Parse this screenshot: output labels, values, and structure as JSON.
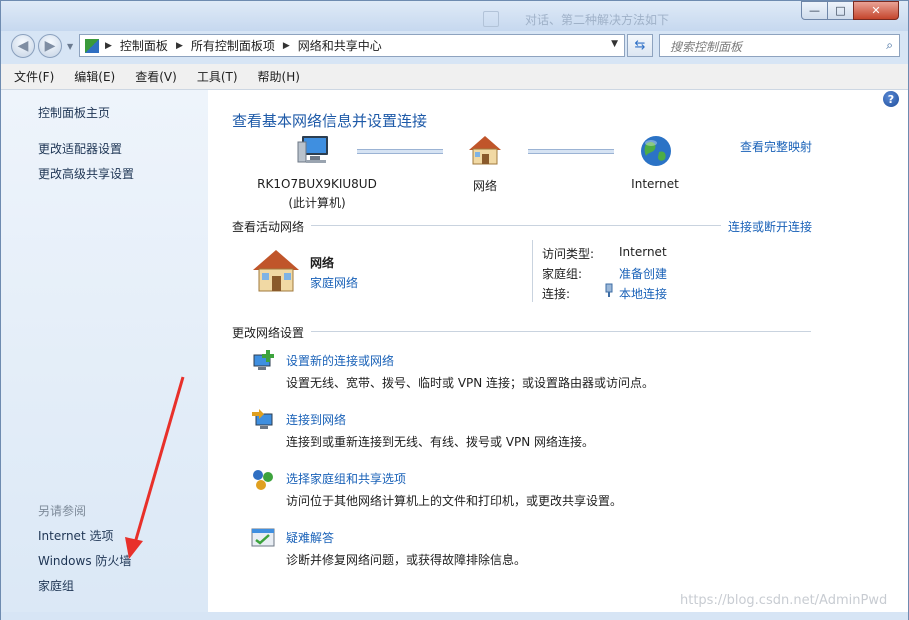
{
  "window": {
    "ghost_text": "对话、第二种解决方法如下",
    "controls": {
      "minimize": "—",
      "maximize": "□",
      "close": "✕"
    }
  },
  "nav": {
    "breadcrumb": [
      "控制面板",
      "所有控制面板项",
      "网络和共享中心"
    ],
    "search_placeholder": "搜索控制面板"
  },
  "menubar": [
    "文件(F)",
    "编辑(E)",
    "查看(V)",
    "工具(T)",
    "帮助(H)"
  ],
  "sidebar": {
    "links": [
      "控制面板主页",
      "更改适配器设置",
      "更改高级共享设置"
    ],
    "see_also_title": "另请参阅",
    "see_also": [
      "Internet 选项",
      "Windows 防火墙",
      "家庭组"
    ]
  },
  "main": {
    "title": "查看基本网络信息并设置连接",
    "view_full_map": "查看完整映射",
    "nodes": {
      "computer_name": "RK1O7BUX9KIU8UD",
      "computer_sub": "(此计算机)",
      "network": "网络",
      "internet": "Internet"
    },
    "active_networks_label": "查看活动网络",
    "connect_disconnect": "连接或断开连接",
    "active": {
      "name": "网络",
      "type": "家庭网络",
      "access_type_label": "访问类型:",
      "access_type_value": "Internet",
      "homegroup_label": "家庭组:",
      "homegroup_value": "准备创建",
      "connection_label": "连接:",
      "connection_value": "本地连接"
    },
    "change_settings_label": "更改网络设置",
    "tasks": [
      {
        "title": "设置新的连接或网络",
        "desc": "设置无线、宽带、拨号、临时或 VPN 连接；或设置路由器或访问点。"
      },
      {
        "title": "连接到网络",
        "desc": "连接到或重新连接到无线、有线、拨号或 VPN 网络连接。"
      },
      {
        "title": "选择家庭组和共享选项",
        "desc": "访问位于其他网络计算机上的文件和打印机，或更改共享设置。"
      },
      {
        "title": "疑难解答",
        "desc": "诊断并修复网络问题，或获得故障排除信息。"
      }
    ]
  },
  "watermark": "https://blog.csdn.net/AdminPwd",
  "colors": {
    "link": "#1a62b8",
    "title": "#1e5aa8",
    "annotation_arrow": "#e8302a",
    "sidebar_bg": "#dbe8f6"
  }
}
